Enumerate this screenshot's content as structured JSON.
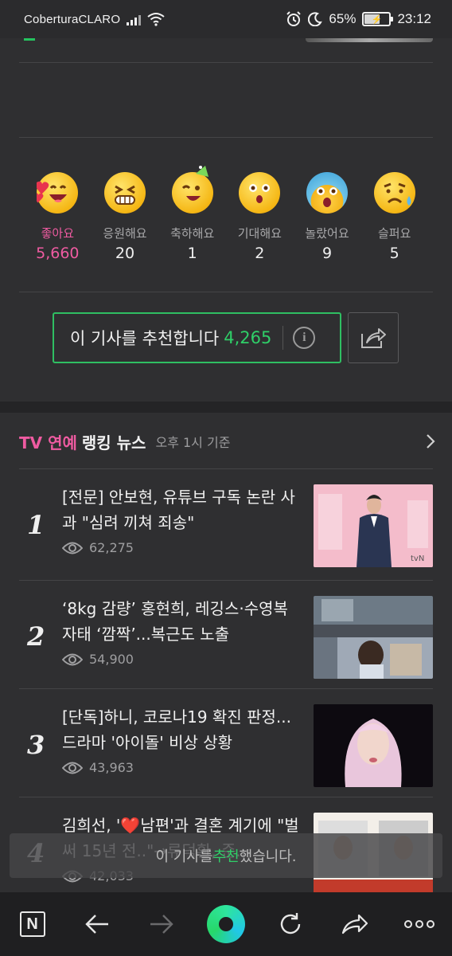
{
  "status_bar": {
    "carrier": "CoberturaCLARO",
    "battery": "65%",
    "battery_level": 0.65,
    "time": "23:12"
  },
  "reactions": [
    {
      "icon": "love-emoji-icon",
      "label": "좋아요",
      "count": "5,660",
      "active": true
    },
    {
      "icon": "cheer-emoji-icon",
      "label": "응원해요",
      "count": "20",
      "active": false
    },
    {
      "icon": "party-emoji-icon",
      "label": "축하해요",
      "count": "1",
      "active": false
    },
    {
      "icon": "expect-emoji-icon",
      "label": "기대해요",
      "count": "2",
      "active": false
    },
    {
      "icon": "surprised-emoji-icon",
      "label": "놀랐어요",
      "count": "9",
      "active": false
    },
    {
      "icon": "sad-emoji-icon",
      "label": "슬퍼요",
      "count": "5",
      "active": false
    }
  ],
  "recommend": {
    "label": "이 기사를 추천합니다",
    "count": "4,265",
    "accent": "#2fbf62"
  },
  "ranking": {
    "title_pink": "TV 연예",
    "title_rest": "랭킹 뉴스",
    "time": "오후 1시 기준",
    "items": [
      {
        "rank": "1",
        "title": "[전문] 안보현, 유튜브 구독 논란 사과 \"심려 끼쳐 죄송\"",
        "views": "62,275"
      },
      {
        "rank": "2",
        "title": "‘8kg 감량’ 홍현희, 레깅스·수영복 자태 ‘깜짝’...복근도 노출",
        "views": "54,900"
      },
      {
        "rank": "3",
        "title": "[단독]하니, 코로나19 확진 판정...드라마 '아이돌' 비상 상황",
        "views": "43,963"
      },
      {
        "rank": "4",
        "title": "김희선, '❤️남편'과 결혼 계기에 \"벌써 15년 전..\"→류덕환, 준..",
        "views": "42,033"
      }
    ]
  },
  "toast": {
    "before": "이 기사를 ",
    "highlight": "추천",
    "after": "했습니다."
  },
  "bottom_nav": [
    "naver-icon",
    "back-icon",
    "forward-icon",
    "green-dot-icon",
    "refresh-icon",
    "share-icon",
    "more-icon"
  ]
}
